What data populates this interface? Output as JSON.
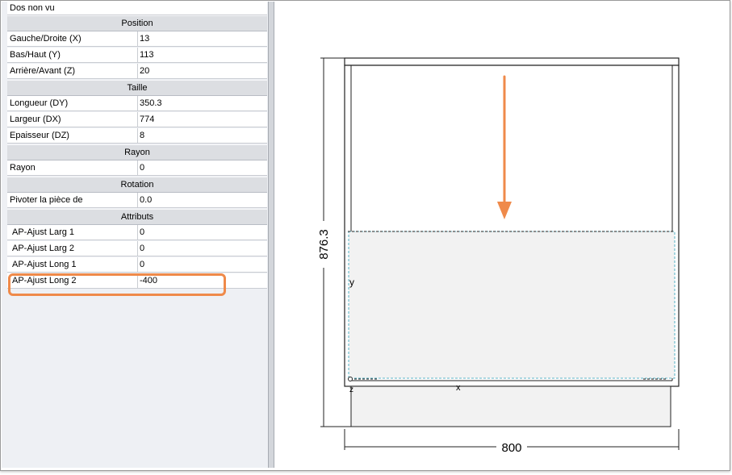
{
  "panel": {
    "top_label": "Dos non vu",
    "sections": [
      {
        "title": "Position",
        "rows": [
          {
            "key": "Gauche/Droite (X)",
            "value": "13"
          },
          {
            "key": "Bas/Haut (Y)",
            "value": "113"
          },
          {
            "key": "Arrière/Avant (Z)",
            "value": "20"
          }
        ]
      },
      {
        "title": "Taille",
        "rows": [
          {
            "key": "Longueur (DY)",
            "value": "350.3"
          },
          {
            "key": "Largeur (DX)",
            "value": "774"
          },
          {
            "key": "Epaisseur (DZ)",
            "value": "8"
          }
        ]
      },
      {
        "title": "Rayon",
        "rows": [
          {
            "key": "Rayon",
            "value": "0"
          }
        ]
      },
      {
        "title": "Rotation",
        "rows": [
          {
            "key": "Pivoter la pièce de",
            "value": "0.0"
          }
        ]
      },
      {
        "title": "Attributs",
        "rows": [
          {
            "key": "AP-Ajust Larg 1",
            "value": "0"
          },
          {
            "key": "AP-Ajust Larg 2",
            "value": "0"
          },
          {
            "key": "AP-Ajust Long 1",
            "value": "0"
          },
          {
            "key": "AP-Ajust Long 2",
            "value": "-400"
          }
        ]
      }
    ]
  },
  "drawing": {
    "height_dimension": "876.3",
    "width_dimension": "800",
    "axis_y_label": "y",
    "axis_z_label": "z",
    "axis_x_label": "x"
  },
  "colors": {
    "highlight": "#ef8a4a",
    "arrow": "#ef8a4a",
    "dash_line": "#2aa0b8",
    "panel_fill": "#f2f2f2"
  }
}
